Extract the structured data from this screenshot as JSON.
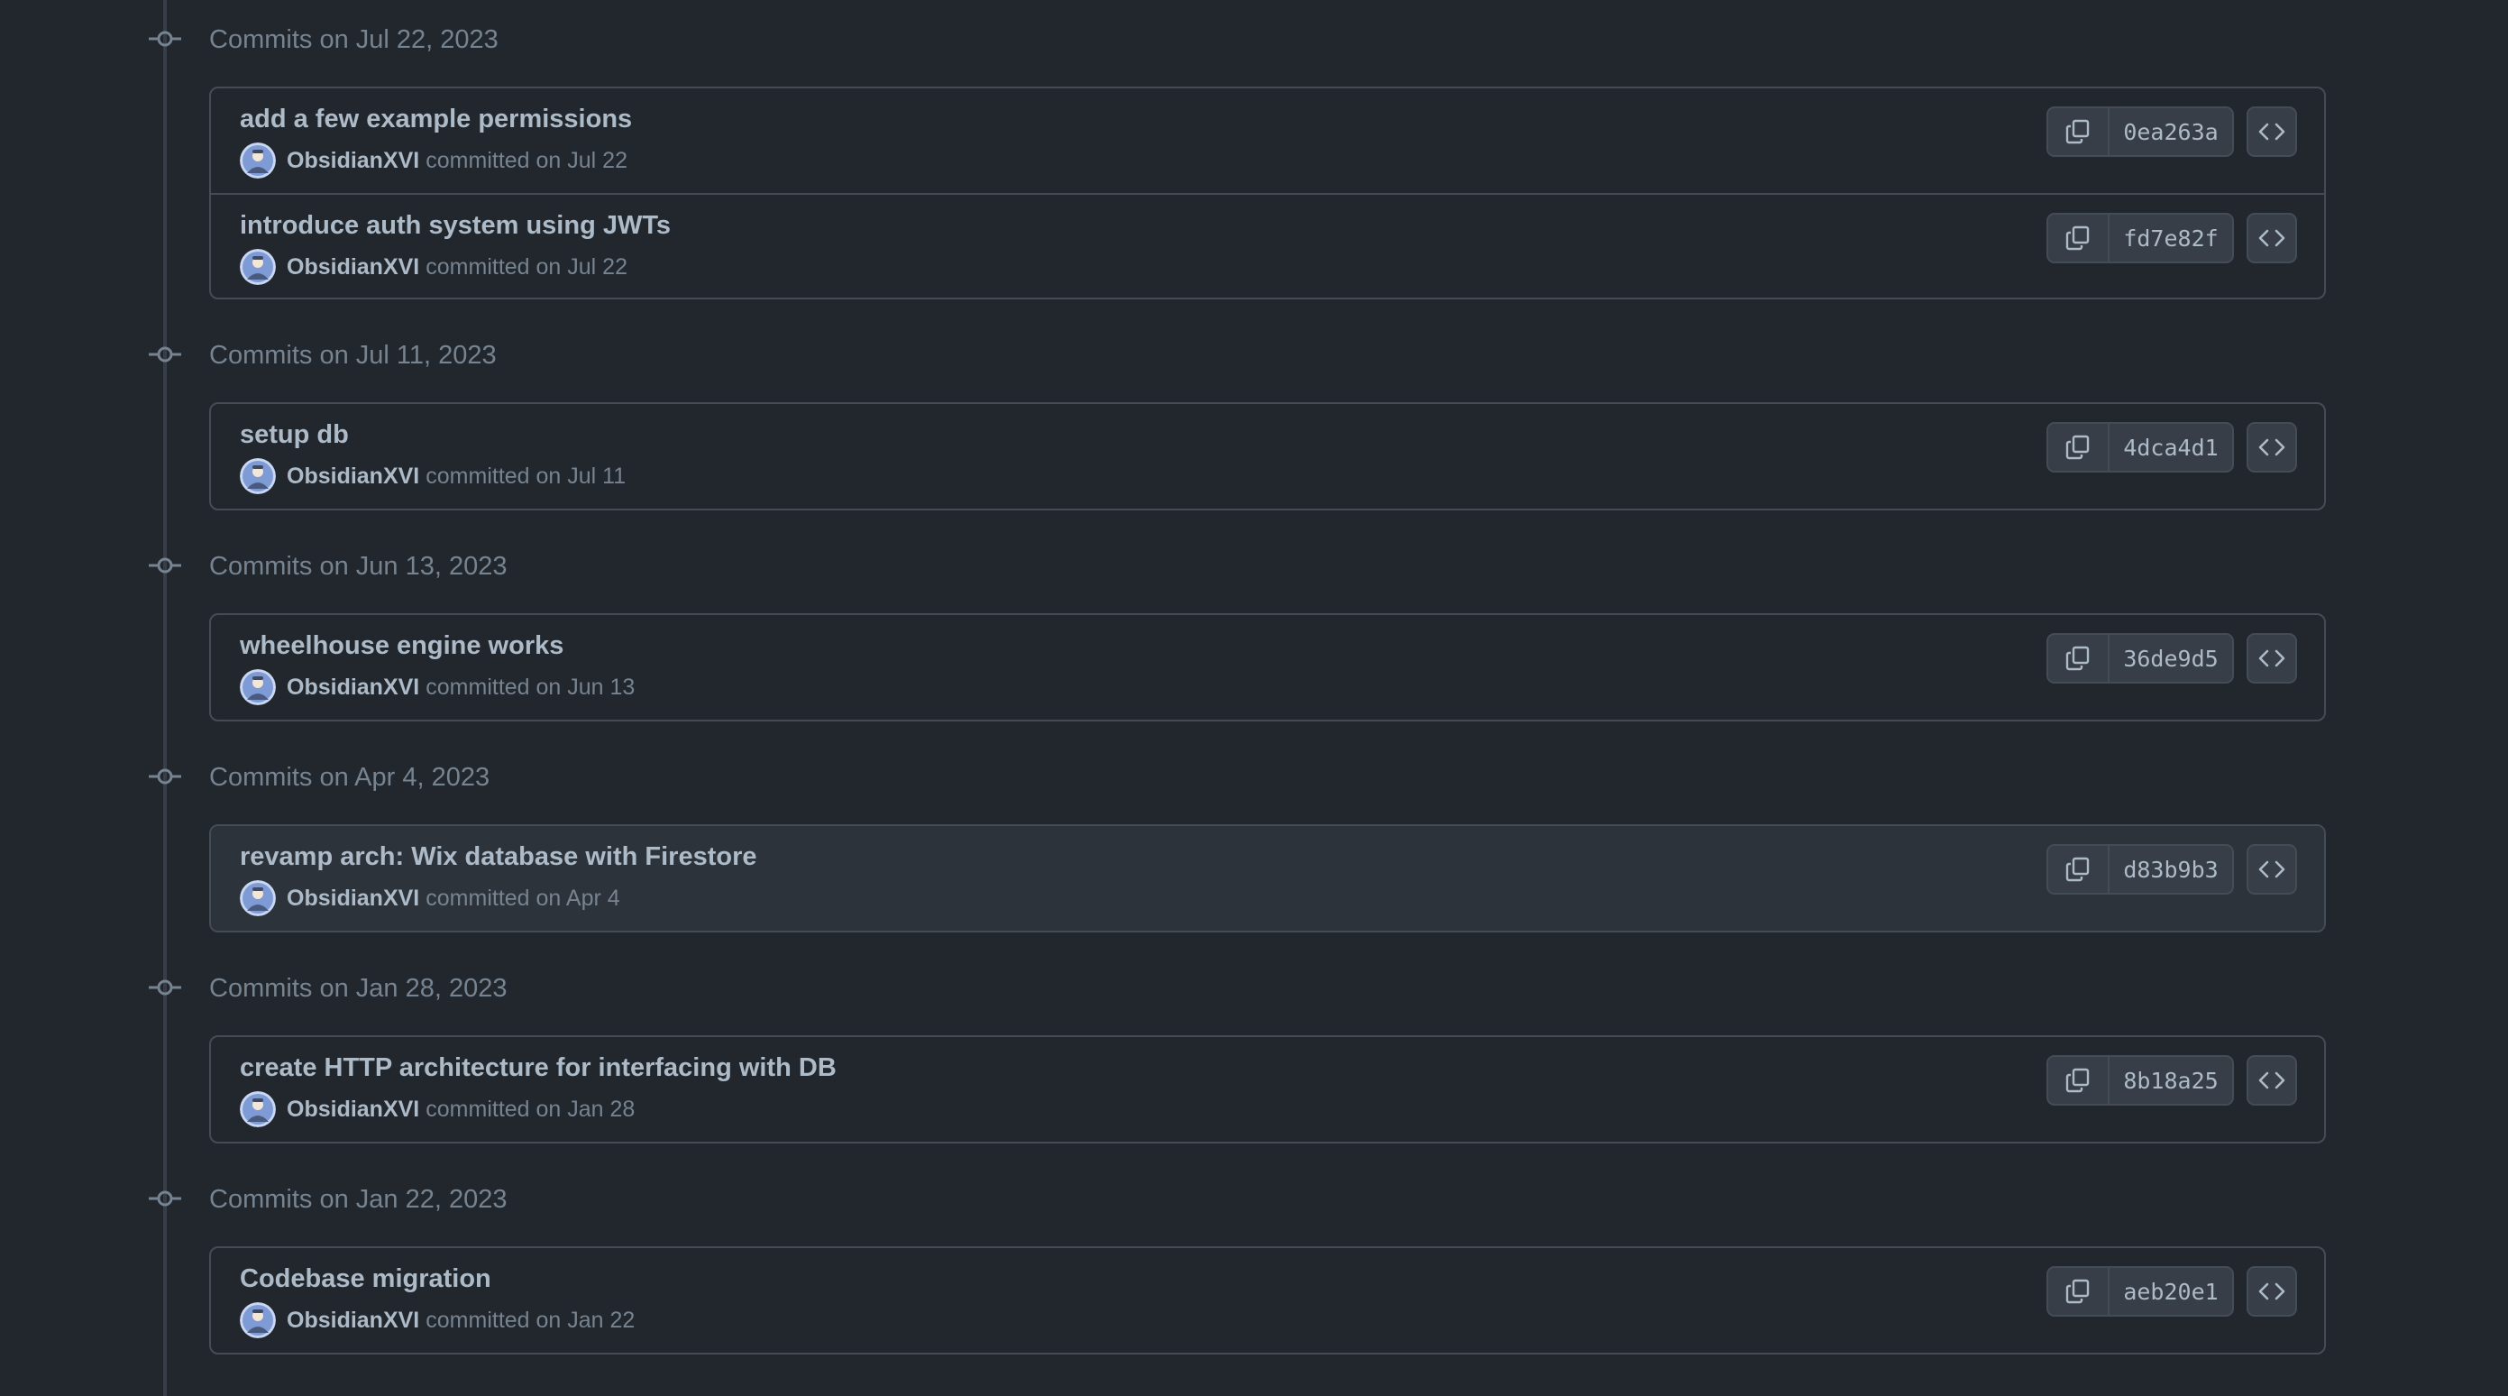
{
  "colors": {
    "background": "#22272e",
    "border": "#444c56",
    "hover_row": "#2d333b",
    "button_bg": "#373e47",
    "text_primary": "#adbac7",
    "text_muted": "#768390"
  },
  "icons": {
    "group_marker": "git-commit-icon",
    "copy": "copy-icon",
    "browse": "code-icon",
    "avatar": "user-avatar"
  },
  "groups": [
    {
      "title": "Commits on Jul 22, 2023",
      "commits": [
        {
          "message": "add a few example permissions",
          "author": "ObsidianXVI",
          "meta": "committed on Jul 22",
          "sha": "0ea263a"
        },
        {
          "message": "introduce auth system using JWTs",
          "author": "ObsidianXVI",
          "meta": "committed on Jul 22",
          "sha": "fd7e82f"
        }
      ]
    },
    {
      "title": "Commits on Jul 11, 2023",
      "commits": [
        {
          "message": "setup db",
          "author": "ObsidianXVI",
          "meta": "committed on Jul 11",
          "sha": "4dca4d1"
        }
      ]
    },
    {
      "title": "Commits on Jun 13, 2023",
      "commits": [
        {
          "message": "wheelhouse engine works",
          "author": "ObsidianXVI",
          "meta": "committed on Jun 13",
          "sha": "36de9d5"
        }
      ]
    },
    {
      "title": "Commits on Apr 4, 2023",
      "commits": [
        {
          "message": "revamp arch: Wix database with Firestore",
          "author": "ObsidianXVI",
          "meta": "committed on Apr 4",
          "sha": "d83b9b3"
        }
      ]
    },
    {
      "title": "Commits on Jan 28, 2023",
      "commits": [
        {
          "message": "create HTTP architecture for interfacing with DB",
          "author": "ObsidianXVI",
          "meta": "committed on Jan 28",
          "sha": "8b18a25"
        }
      ]
    },
    {
      "title": "Commits on Jan 22, 2023",
      "commits": [
        {
          "message": "Codebase migration",
          "author": "ObsidianXVI",
          "meta": "committed on Jan 22",
          "sha": "aeb20e1"
        }
      ]
    }
  ]
}
